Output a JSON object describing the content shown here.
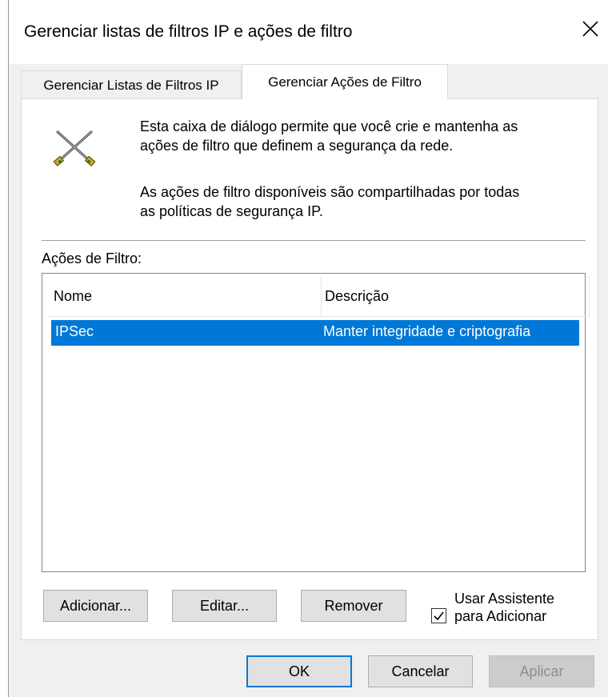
{
  "window": {
    "title": "Gerenciar listas de filtros IP e ações de filtro"
  },
  "tabs": [
    {
      "label": "Gerenciar Listas de Filtros IP",
      "active": false
    },
    {
      "label": "Gerenciar Ações de Filtro",
      "active": true
    }
  ],
  "panel": {
    "icon": "filter-action-tools-icon",
    "description_line1": "Esta caixa de diálogo permite que você crie e mantenha as",
    "description_line2": "ações de filtro que definem a segurança da rede.",
    "info_line1": "As ações de filtro disponíveis são compartilhadas por todas",
    "info_line2": "as políticas de segurança IP.",
    "list_label": "Ações de Filtro:"
  },
  "list": {
    "columns": [
      "Nome",
      "Descrição"
    ],
    "rows": [
      {
        "name": "IPSec",
        "description": "Manter integridade e criptografia",
        "selected": true
      }
    ]
  },
  "actions": {
    "add": "Adicionar...",
    "edit": "Editar...",
    "remove": "Remover",
    "wizard_checkbox_line1": "Usar Assistente",
    "wizard_checkbox_line2": "para Adicionar",
    "wizard_checked": true
  },
  "footer": {
    "ok": "OK",
    "cancel": "Cancelar",
    "apply": "Aplicar"
  },
  "colors": {
    "selection": "#0078d7",
    "dialog_bg": "#f0f0f0",
    "button_bg": "#e1e1e1"
  }
}
